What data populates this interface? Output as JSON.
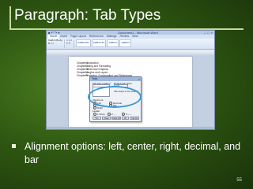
{
  "slide": {
    "title": "Paragraph: Tab Types",
    "bullet": "Alignment options: left, center, right, decimal, and bar",
    "page_number": "55"
  },
  "app": {
    "quick_access": "■ ↶ ↷ ▾",
    "title": "Document1 - Microsoft Word",
    "tabs": [
      "Home",
      "Insert",
      "Page Layout",
      "References",
      "Mailings",
      "Review",
      "View"
    ],
    "groups": [
      {
        "lines": [
          "Calibri (Body)",
          "B I U"
        ]
      },
      {
        "lines": [
          "≡ ≡ ≡",
          "¶ ☰"
        ]
      }
    ],
    "styles": [
      "AaBbCcDc",
      "AaBbCcDc",
      "AaBbCc",
      "AaBbCc"
    ]
  },
  "document": {
    "toc_lines": [
      {
        "chapter": "Chapter 1",
        "title": "Introduction"
      },
      {
        "chapter": "Chapter 2",
        "title": "Editing and Formatting"
      },
      {
        "chapter": "Chapter 3",
        "title": "Tables and Graphics"
      },
      {
        "chapter": "Chapter 4",
        "title": "Margins and Layout"
      },
      {
        "chapter": "Chapter 5",
        "title": "Reviewing, Proofreading, and References"
      }
    ]
  },
  "tabs_dialog": {
    "title": "Tabs",
    "tab_stop_label": "Tab stop position:",
    "default_label": "Default tab stops:",
    "default_value": "0.5\"",
    "clear_label": "Tab stops to be cleared:",
    "alignment_label": "Alignment",
    "alignment_options": [
      "Left",
      "Center",
      "Right",
      "Decimal",
      "Bar"
    ],
    "leader_label": "Leader",
    "leader_options": [
      "1 None",
      "2 .....",
      "3 -----",
      "4 ____"
    ],
    "buttons": [
      "Set",
      "Clear",
      "Clear All",
      "OK",
      "Cancel"
    ]
  },
  "colors": {
    "background": "#2f5812",
    "highlight_ring": "#3b9ad8",
    "title_rule": "#c8d6a0"
  }
}
